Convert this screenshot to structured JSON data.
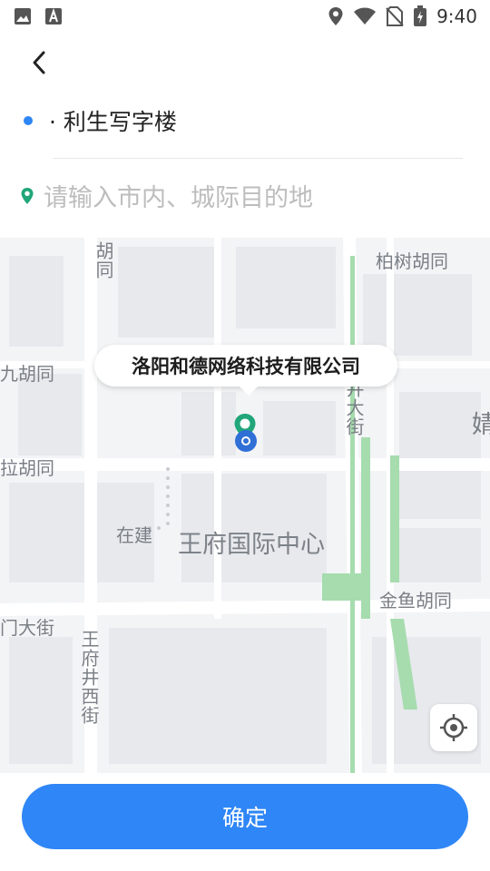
{
  "status_bar": {
    "time": "9:40",
    "left_icons": [
      "image-icon",
      "font-a-icon"
    ],
    "right_icons": [
      "location-icon",
      "wifi-icon",
      "no-sim-icon",
      "battery-charging-icon"
    ]
  },
  "route": {
    "start_text": "· 利生写字楼",
    "destination_placeholder": "请输入市内、城际目的地",
    "destination_value": ""
  },
  "map": {
    "callout": "洛阳和德网络科技有限公司",
    "labels": {
      "hutong_v": "胡同",
      "bai_shu_hutong": "柏树胡同",
      "jiu_hutong": "九胡同",
      "la_hutong": "拉胡同",
      "zai_jian": "在建",
      "wangfu_center": "王府国际中心",
      "jinyu_hutong": "金鱼胡同",
      "men_da_jie": "门大街",
      "wangfujing_xijie": "王府井西街",
      "jing_da_jie": "井大街",
      "jiu_top": "约",
      "edge_char": "婧"
    }
  },
  "actions": {
    "confirm_label": "确定"
  },
  "colors": {
    "accent": "#2f86f6",
    "pin_green": "#21a67a",
    "map_bg": "#f3f4f6"
  }
}
